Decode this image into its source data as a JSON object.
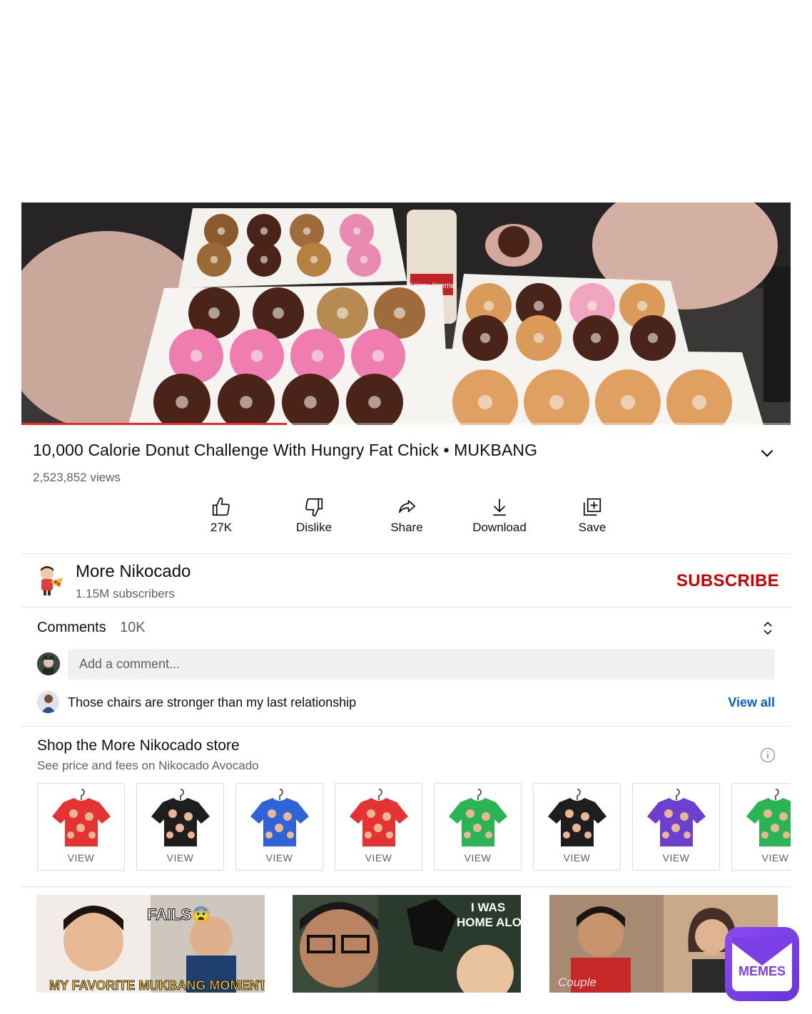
{
  "video": {
    "title": "10,000 Calorie Donut Challenge With Hungry Fat Chick • MUKBANG",
    "views": "2,523,852 views",
    "progress_fraction": 0.345,
    "cup_brand": "Krispy Kreme"
  },
  "actions": [
    {
      "label": "27K",
      "icon": "thumbs-up-icon"
    },
    {
      "label": "Dislike",
      "icon": "thumbs-down-icon"
    },
    {
      "label": "Share",
      "icon": "share-icon"
    },
    {
      "label": "Download",
      "icon": "download-icon"
    },
    {
      "label": "Save",
      "icon": "save-to-playlist-icon"
    }
  ],
  "channel": {
    "name": "More Nikocado",
    "subscribers": "1.15M subscribers",
    "subscribe_label": "SUBSCRIBE"
  },
  "comments": {
    "label": "Comments",
    "count": "10K",
    "placeholder": "Add a comment...",
    "top_comment": "Those chairs are stronger than my last relationship",
    "view_all": "View all"
  },
  "shop": {
    "title": "Shop the More Nikocado store",
    "subtitle": "See price and fees on Nikocado Avocado",
    "item_label": "VIEW",
    "shirt_colors": [
      "#e53232",
      "#1e1e1e",
      "#2f64d8",
      "#e53232",
      "#2ab453",
      "#1e1e1e",
      "#6b3fd0",
      "#2ab453"
    ]
  },
  "recommended": [
    {
      "overlay_top": "FAILS😨",
      "overlay_bottom": "MY FAVORITE MUKBANG MOMENTS"
    },
    {
      "overlay_top": "I WAS",
      "overlay_bottom": "HOME ALONE"
    },
    {
      "overlay_top": "",
      "overlay_bottom": "Couple"
    }
  ],
  "watermark": {
    "text": "MEMES"
  },
  "colors": {
    "subscribe": "#cc0000",
    "link": "#065fd4",
    "progress": "#e52d27",
    "memes_purple": "#7b3fe4"
  }
}
